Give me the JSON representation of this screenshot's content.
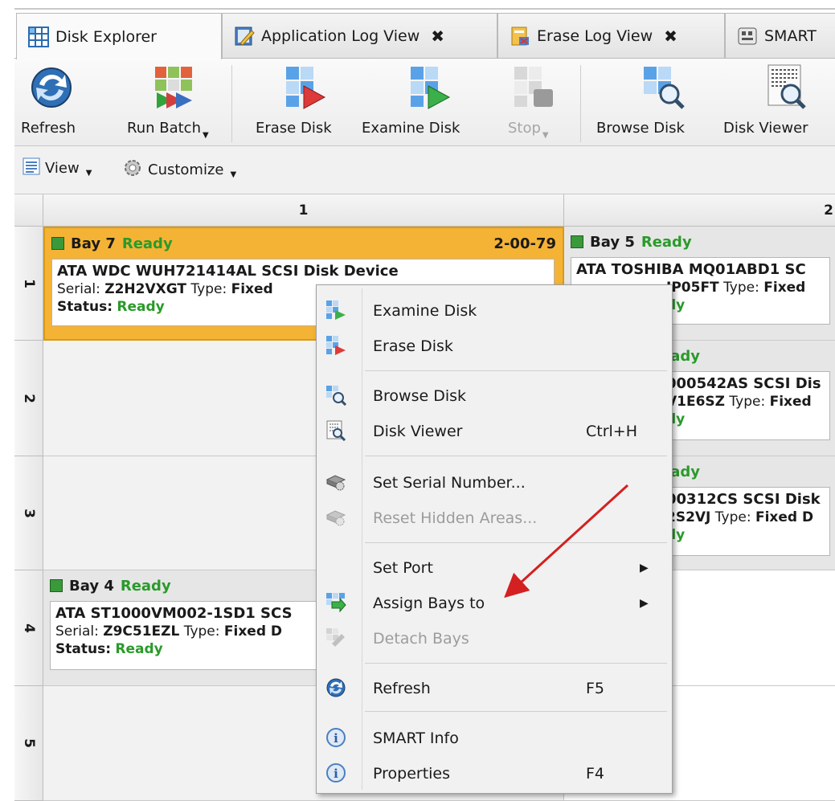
{
  "tabs": [
    {
      "label": "Disk Explorer",
      "icon": "grid-icon",
      "active": true,
      "closable": false
    },
    {
      "label": "Application Log View",
      "icon": "log-icon",
      "active": false,
      "closable": true
    },
    {
      "label": "Erase Log View",
      "icon": "erase-log-icon",
      "active": false,
      "closable": true
    },
    {
      "label": "SMART",
      "icon": "smart-icon",
      "active": false,
      "closable": false
    }
  ],
  "tab_close": "✖",
  "ribbon": {
    "refresh": "Refresh",
    "run_batch": "Run Batch",
    "erase_disk": "Erase Disk",
    "examine_disk": "Examine Disk",
    "stop": "Stop",
    "browse_disk": "Browse Disk",
    "disk_viewer": "Disk Viewer"
  },
  "viewbar": {
    "view": "View",
    "customize": "Customize"
  },
  "grid": {
    "columns": [
      "1",
      "2"
    ],
    "rows": [
      "1",
      "2",
      "3",
      "4",
      "5"
    ]
  },
  "bays": {
    "bay7": {
      "name": "Bay 7",
      "state": "Ready",
      "port": "2-00-79",
      "device": "ATA WDC WUH721414AL SCSI Disk Device",
      "serial_label": "Serial:",
      "serial": "Z2H2VXGT",
      "type_label": "Type:",
      "type": "Fixed",
      "status_label": "Status:",
      "status": "Ready"
    },
    "bay5": {
      "name": "Bay 5",
      "state": "Ready",
      "device": "ATA TOSHIBA MQ01ABD1 SC",
      "serial": "JP05FT",
      "type_label": "Type:",
      "type": "Fixed",
      "status": "dy"
    },
    "bay_r2c2": {
      "state": "eady",
      "device": "000542AS SCSI Dis",
      "serial": "V1E6SZ",
      "type_label": "Type:",
      "type": "Fixed",
      "status": "dy"
    },
    "bay_r3c2": {
      "state": "eady",
      "device": "00312CS SCSI Disk",
      "serial": "2S2VJ",
      "type_label": "Type:",
      "type": "Fixed D",
      "status": "dy"
    },
    "bay4": {
      "name": "Bay 4",
      "state": "Ready",
      "device": "ATA ST1000VM002-1SD1 SCS",
      "serial_label": "Serial:",
      "serial": "Z9C51EZL",
      "type_label": "Type:",
      "type": "Fixed D",
      "status_label": "Status:",
      "status": "Ready"
    }
  },
  "menu": {
    "examine_disk": "Examine Disk",
    "erase_disk": "Erase Disk",
    "browse_disk": "Browse Disk",
    "disk_viewer": "Disk Viewer",
    "disk_viewer_key": "Ctrl+H",
    "set_serial": "Set Serial Number...",
    "reset_hidden": "Reset Hidden Areas...",
    "set_port": "Set Port",
    "assign_bays": "Assign Bays to",
    "detach_bays": "Detach Bays",
    "refresh": "Refresh",
    "refresh_key": "F5",
    "smart_info": "SMART Info",
    "properties": "Properties",
    "properties_key": "F4",
    "submenu_arrow": "▶"
  },
  "colors": {
    "accent_orange": "#f5b335",
    "ready_green": "#2a9a2a",
    "annotation_red": "#d42020"
  }
}
